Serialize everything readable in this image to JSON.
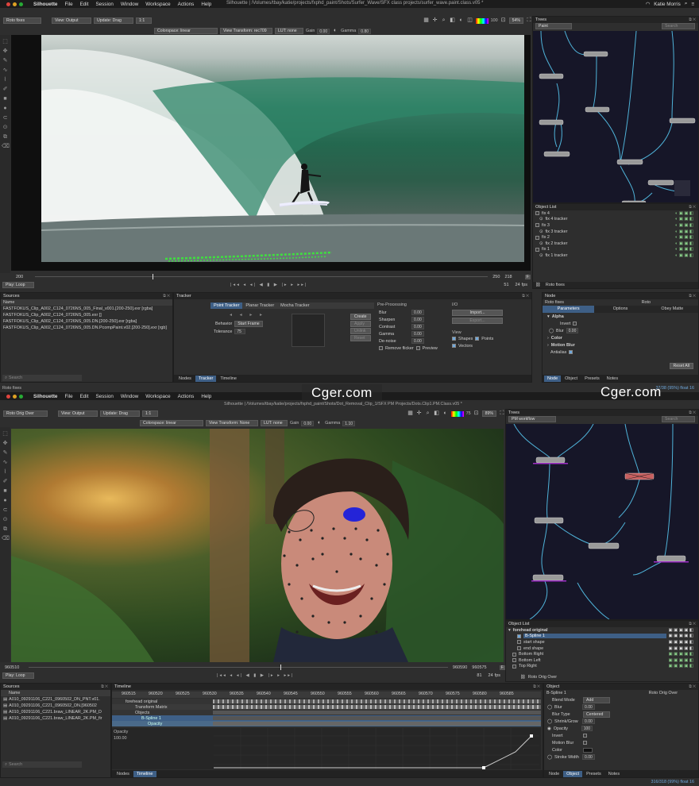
{
  "top": {
    "menubar": {
      "app": "Silhouette",
      "menus": [
        "File",
        "Edit",
        "Session",
        "Window",
        "Workspace",
        "Actions",
        "Help"
      ],
      "title": "Silhouette | /Volumes/tbay/katie/projects/fxphd_paint/Shots/Surfer_Wave/SFX class projects/surfer_wave.paint.class.v05 *",
      "user": "Katie Morris"
    },
    "toolbar1": {
      "node_dd": "Roto fixes",
      "view_dd": "View: Output",
      "update_dd": "Update: Drag",
      "ratio_dd": "1:1",
      "zoom": "100",
      "zoom_pct": "54%"
    },
    "toolbar2": {
      "colorspace": "Colorspace: linear",
      "view_transform": "View Transform: rec709",
      "lut": "LUT: none",
      "gain_label": "Gain",
      "gain_val": "0.00",
      "gamma_label": "Gamma",
      "gamma_val": "0.80"
    },
    "scrub": {
      "start": "200",
      "mid": "250",
      "cur": "218",
      "end": "51",
      "fps": "24",
      "fps_label": "fps",
      "play": "Play: Loop",
      "tools_label": "Roto fixes"
    },
    "trees": {
      "title": "Trees",
      "tree_dd": "Paint",
      "search": "Search"
    },
    "objlist": {
      "title": "Object List",
      "items": [
        "fix 4",
        "fix 4 tracker",
        "fix 3",
        "fix 3 tracker",
        "fix 2",
        "fix 2 tracker",
        "fix 1",
        "fix 1 tracker"
      ]
    },
    "sources": {
      "title": "Sources",
      "col": "Name",
      "items": [
        "FASTFOKUS_Clip_A002_C124_0726NS_005_Final_v001.[200-250].exr [rgba]",
        "FASTFOKUS_Clip_A002_C124_0726NS_005.exr []",
        "FASTFOKUS_Clip_A002_C124_0726NS_005.DN.[200-250].exr [rgba]",
        "FASTFOKUS_Clip_A002_C124_0726NS_005.DN.PcompPaint.v02.[200-250].exr [rgb]"
      ],
      "search": "Search"
    },
    "tracker": {
      "title": "Tracker",
      "point": "Point Tracker",
      "planar": "Planar Tracker",
      "mocha": "Mocha Tracker",
      "behavior_lbl": "Behavior",
      "behavior": "Start Frame",
      "tolerance_lbl": "Tolerance",
      "tolerance": "75",
      "create": "Create",
      "apply": "Apply",
      "unlink": "Unlink",
      "reset": "Reset",
      "pre_title": "Pre-Processing",
      "pre": [
        {
          "k": "Blur",
          "v": "0.00"
        },
        {
          "k": "Sharpen",
          "v": "0.00"
        },
        {
          "k": "Contrast",
          "v": "0.00"
        },
        {
          "k": "Gamma",
          "v": "0.00"
        },
        {
          "k": "De-noise",
          "v": "0.00"
        }
      ],
      "remove_flicker": "Remove flicker",
      "preview": "Preview",
      "io": "I/O",
      "import": "Import...",
      "export": "Export...",
      "view": "View",
      "shapes": "Shapes",
      "points": "Points",
      "vectors": "Vectors"
    },
    "bottom_tabs": [
      "Nodes",
      "Tracker",
      "Timeline"
    ],
    "node": {
      "title": "Node",
      "name": "Roto fixes",
      "type": "Roto",
      "tabs": [
        "Parameters",
        "Options",
        "Obey Matte"
      ],
      "alpha": "Alpha",
      "invert": "Invert",
      "blur": "Blur",
      "blur_val": "0.00",
      "color": "Color",
      "motion_blur": "Motion Blur",
      "antialias": "Antialias",
      "reset": "Reset All",
      "tabs2": [
        "Node",
        "Object",
        "Presets",
        "Notes"
      ],
      "status": "37/38 (95%) float 16"
    }
  },
  "bottom": {
    "menubar": {
      "app": "Silhouette",
      "menus": [
        "File",
        "Edit",
        "Session",
        "Window",
        "Workspace",
        "Actions",
        "Help"
      ],
      "title": "Silhouette | /Volumes/tbay/katie/projects/fxphd_paint/Shots/Dot_Removal_Clip_1/SFX PM Projects/Dots.Clip1.PM.Class.v05 *",
      "tools_label": "Roto fixes"
    },
    "toolbar1": {
      "node_dd": "Roto Orig Over",
      "view_dd": "View: Output",
      "update_dd": "Update: Drag",
      "ratio_dd": "1:1",
      "zoom": "75",
      "zoom_pct": "89%"
    },
    "toolbar2": {
      "colorspace": "Colorspace: linear",
      "view_transform": "View Transform: None",
      "lut": "LUT: none",
      "gain_label": "Gain",
      "gain_val": "0.00",
      "gamma_label": "Gamma",
      "gamma_val": "1.10"
    },
    "scrub": {
      "start": "960510",
      "mid": "960590",
      "cur": "960575",
      "end": "81",
      "fps": "24",
      "fps_label": "fps",
      "play": "Play: Loop",
      "tools_label": "Roto Orig Over"
    },
    "trees": {
      "title": "Trees",
      "tree_dd": "PM workflow",
      "search": "Search"
    },
    "objlist": {
      "title": "Object List",
      "items": [
        "forehead original",
        "B-Spline 1",
        "start shape",
        "end shape",
        "Bottom Right",
        "Bottom Left",
        "Top Right"
      ]
    },
    "sources": {
      "title": "Sources",
      "col": "Name",
      "items": [
        "A010_09291106_C221_0960502_DN_PNT.v01.",
        "A010_09291106_C221_0960502_DN.[960502",
        "A010_09291106_C221.braw_LINEAR_2K.PM_D",
        "A010_09291106_C221.braw_LINEAR_2K.PM_fir"
      ],
      "search": "Search"
    },
    "timeline": {
      "title": "Timeline",
      "ticks": [
        "960515",
        "960520",
        "960525",
        "960530",
        "960535",
        "960540",
        "960545",
        "960550",
        "960555",
        "960560",
        "960565",
        "960570",
        "960575",
        "960580",
        "960585"
      ],
      "tracks": [
        "forehead original",
        "Transform Matrix",
        "Objects",
        "B-Spline 1",
        "Opacity"
      ],
      "opacity_lbl": "Opacity",
      "opacity_val": "100.00"
    },
    "bottom_tabs": [
      "Nodes",
      "Timeline"
    ],
    "object": {
      "title": "Object",
      "name": "B-Spline 1",
      "node": "Roto Orig Over",
      "params": [
        {
          "k": "Blend Mode",
          "v": "Add"
        },
        {
          "k": "Blur",
          "v": "0.00"
        },
        {
          "k": "Blur Type",
          "v": "Centered"
        },
        {
          "k": "Shrink/Grow",
          "v": "0.00"
        },
        {
          "k": "Opacity",
          "v": "100"
        },
        {
          "k": "Invert",
          "v": ""
        },
        {
          "k": "Motion Blur",
          "v": ""
        },
        {
          "k": "Color",
          "v": ""
        },
        {
          "k": "Stroke Width",
          "v": "0.00"
        }
      ],
      "tabs2": [
        "Node",
        "Object",
        "Presets",
        "Notes"
      ],
      "status": "316/318 (99%) float 16"
    }
  },
  "watermark": "Cger.com",
  "colors": {
    "accent": "#3e5f86",
    "node_bg": "#161628",
    "wire": "#4fb3d9"
  }
}
